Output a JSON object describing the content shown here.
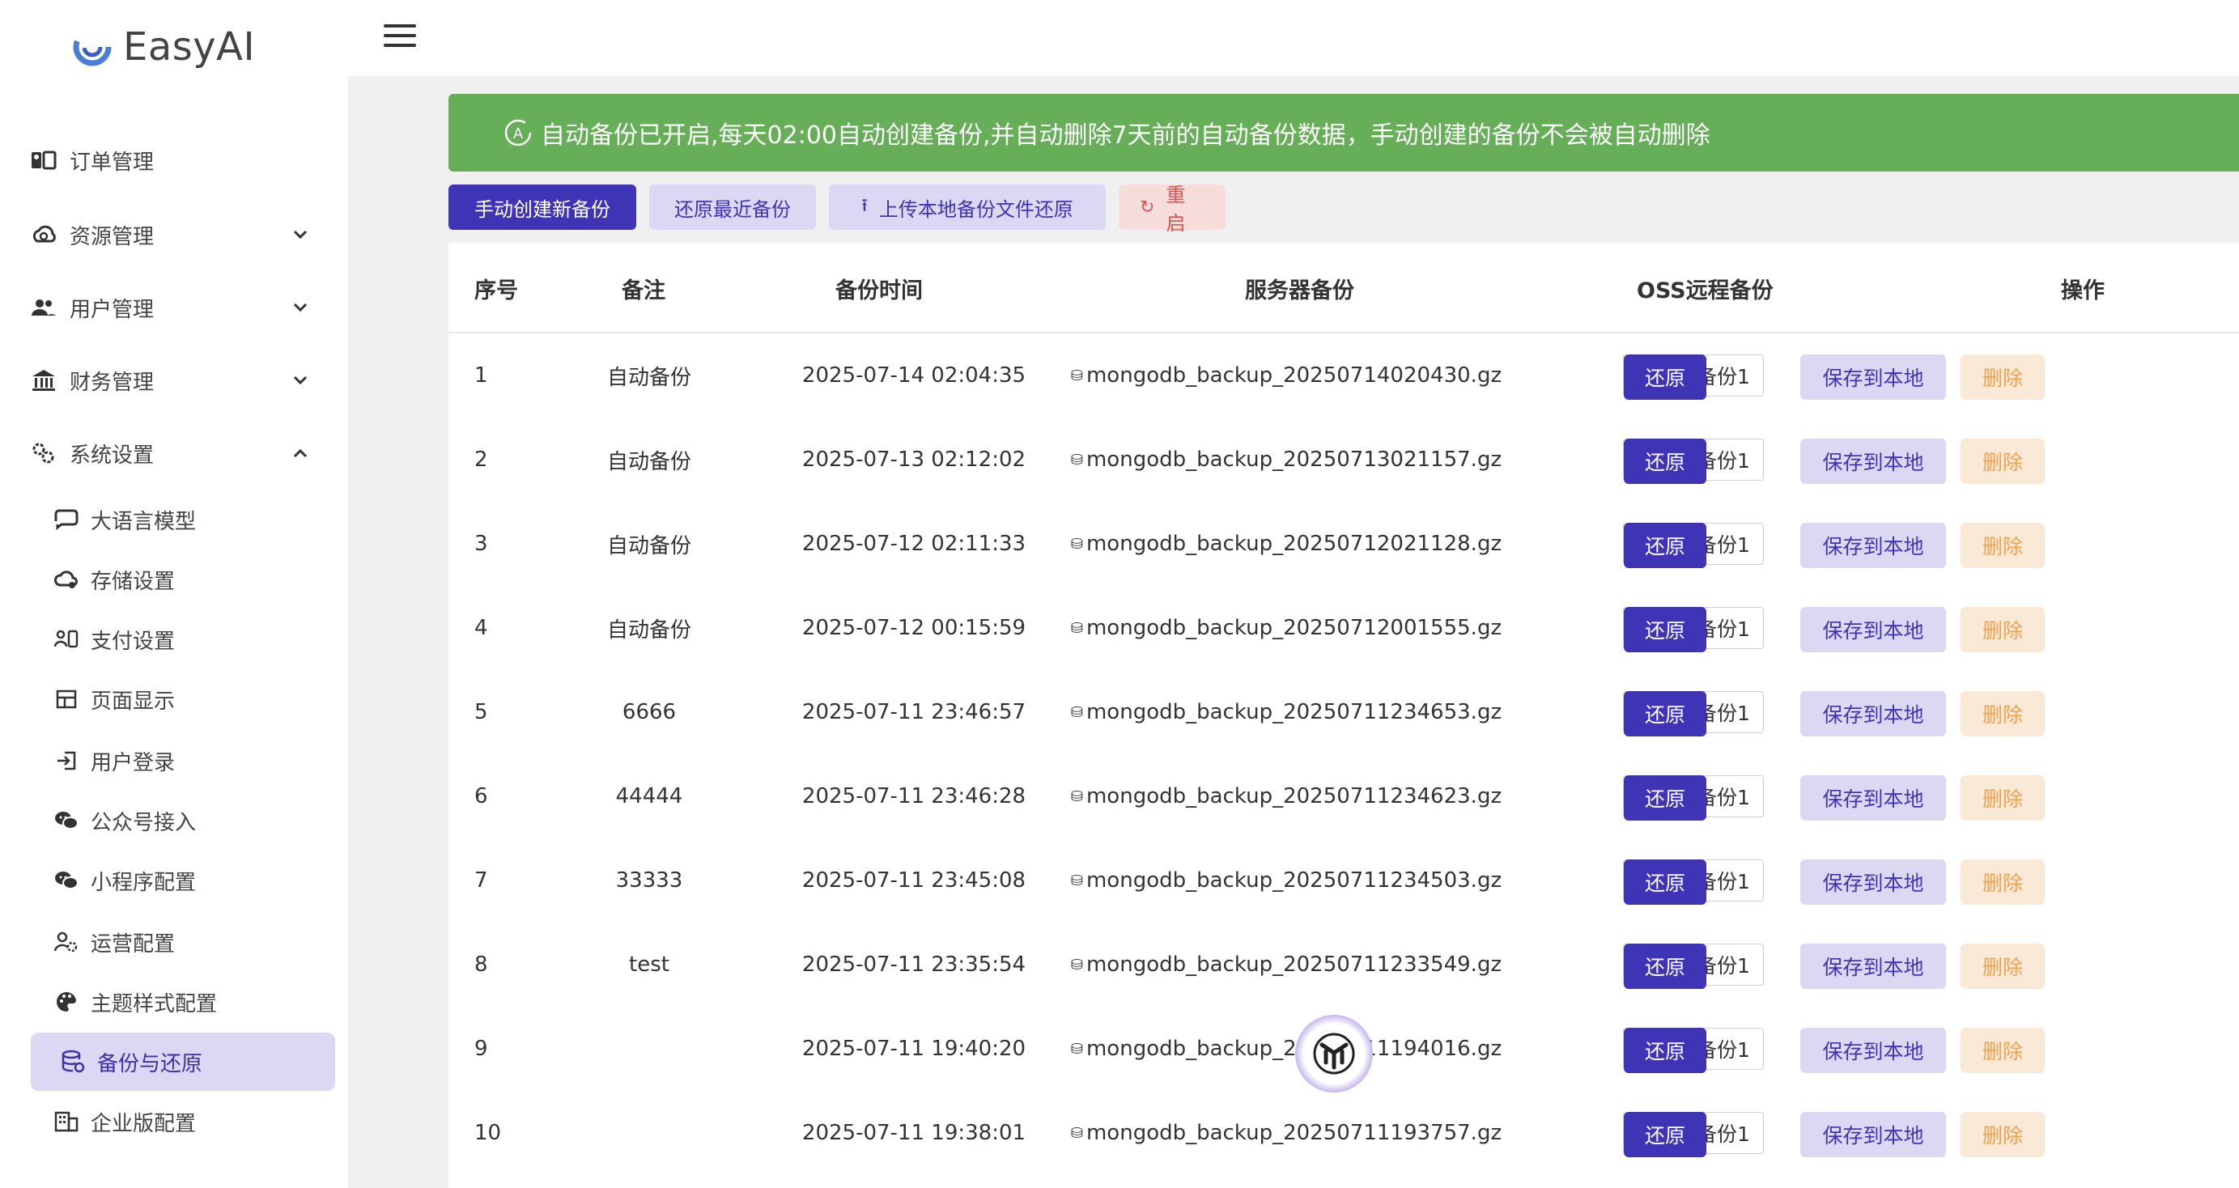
{
  "app": {
    "name": "EasyAI"
  },
  "sidebar": {
    "items": [
      {
        "label": "订单管理",
        "icon": "orders-icon"
      },
      {
        "label": "资源管理",
        "icon": "resource-icon"
      },
      {
        "label": "用户管理",
        "icon": "users-icon"
      },
      {
        "label": "财务管理",
        "icon": "finance-icon"
      },
      {
        "label": "系统设置",
        "icon": "settings-icon"
      }
    ],
    "sub_items": [
      {
        "label": "大语言模型",
        "icon": "chat-icon"
      },
      {
        "label": "存储设置",
        "icon": "cloud-settings-icon"
      },
      {
        "label": "支付设置",
        "icon": "payment-icon"
      },
      {
        "label": "页面显示",
        "icon": "layout-icon"
      },
      {
        "label": "用户登录",
        "icon": "login-icon"
      },
      {
        "label": "公众号接入",
        "icon": "wechat-icon"
      },
      {
        "label": "小程序配置",
        "icon": "miniprogram-icon"
      },
      {
        "label": "运营配置",
        "icon": "operation-icon"
      },
      {
        "label": "主题样式配置",
        "icon": "palette-icon"
      },
      {
        "label": "备份与还原",
        "icon": "backup-icon"
      },
      {
        "label": "企业版配置",
        "icon": "enterprise-icon"
      }
    ]
  },
  "banner": {
    "text": "自动备份已开启,每天02:00自动创建备份,并自动删除7天前的自动备份数据，手动创建的备份不会被自动删除"
  },
  "toolbar": {
    "create": "手动创建新备份",
    "restore_latest": "还原最近备份",
    "upload_restore": "上传本地备份文件还原",
    "restart": "重启"
  },
  "table": {
    "headers": [
      "序号",
      "备注",
      "备份时间",
      "服务器备份",
      "OSS远程备份",
      "操作"
    ],
    "oss_label": "云端备份1",
    "actions": {
      "restore": "还原",
      "save": "保存到本地",
      "delete": "删除"
    },
    "rows": [
      {
        "no": "1",
        "note": "自动备份",
        "time": "2025-07-14 02:04:35",
        "file": "mongodb_backup_20250714020430.gz"
      },
      {
        "no": "2",
        "note": "自动备份",
        "time": "2025-07-13 02:12:02",
        "file": "mongodb_backup_20250713021157.gz"
      },
      {
        "no": "3",
        "note": "自动备份",
        "time": "2025-07-12 02:11:33",
        "file": "mongodb_backup_20250712021128.gz"
      },
      {
        "no": "4",
        "note": "自动备份",
        "time": "2025-07-12 00:15:59",
        "file": "mongodb_backup_20250712001555.gz"
      },
      {
        "no": "5",
        "note": "6666",
        "time": "2025-07-11 23:46:57",
        "file": "mongodb_backup_20250711234653.gz"
      },
      {
        "no": "6",
        "note": "44444",
        "time": "2025-07-11 23:46:28",
        "file": "mongodb_backup_20250711234623.gz"
      },
      {
        "no": "7",
        "note": "33333",
        "time": "2025-07-11 23:45:08",
        "file": "mongodb_backup_20250711234503.gz"
      },
      {
        "no": "8",
        "note": "test",
        "time": "2025-07-11 23:35:54",
        "file": "mongodb_backup_20250711233549.gz"
      },
      {
        "no": "9",
        "note": "",
        "time": "2025-07-11 19:40:20",
        "file": "mongodb_backup_20250711194016.gz"
      },
      {
        "no": "10",
        "note": "",
        "time": "2025-07-11 19:38:01",
        "file": "mongodb_backup_20250711193757.gz"
      }
    ]
  },
  "colors": {
    "primary": "#3f33b6",
    "primary_soft": "#dcd8f4",
    "banner": "#67ae58",
    "danger": "#d9534f",
    "warning": "#f1a14a"
  }
}
